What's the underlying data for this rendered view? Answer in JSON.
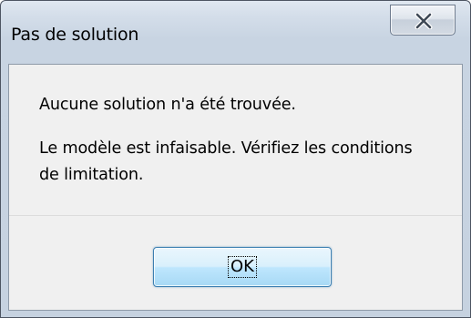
{
  "window": {
    "title": "Pas de solution"
  },
  "message": {
    "line1": "Aucune solution n'a été trouvée.",
    "line2": "Le modèle est infaisable. Vérifiez les conditions de limitation."
  },
  "buttons": {
    "ok_label": "OK"
  },
  "icons": {
    "close": "close-x-icon"
  }
}
